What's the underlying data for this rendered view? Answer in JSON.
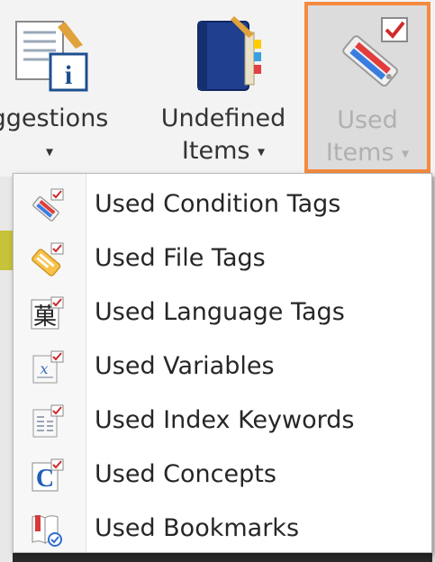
{
  "ribbon": {
    "suggestions": {
      "label": "ggestions",
      "icon": "suggestions-info-icon"
    },
    "undefined_items": {
      "label_line1": "Undefined",
      "label_line2": "Items",
      "icon": "book-icon"
    },
    "used_items": {
      "label_line1": "Used",
      "label_line2": "Items",
      "icon": "used-tags-icon",
      "state": "pressed",
      "highlight_color": "#f38a3f"
    }
  },
  "caret": "▾",
  "menu": {
    "items": [
      {
        "label": "Used Condition Tags",
        "icon": "condition-tags-icon"
      },
      {
        "label": "Used File Tags",
        "icon": "file-tags-icon"
      },
      {
        "label": "Used Language Tags",
        "icon": "language-tags-icon"
      },
      {
        "label": "Used Variables",
        "icon": "variables-icon"
      },
      {
        "label": "Used Index Keywords",
        "icon": "index-keywords-icon"
      },
      {
        "label": "Used Concepts",
        "icon": "concepts-icon"
      },
      {
        "label": "Used Bookmarks",
        "icon": "bookmarks-icon"
      }
    ]
  }
}
